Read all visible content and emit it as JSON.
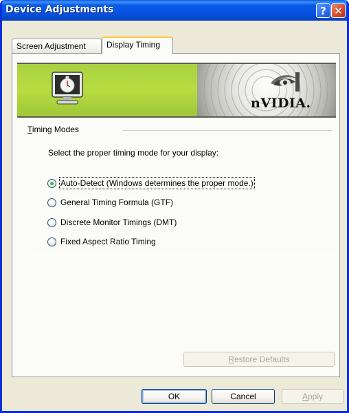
{
  "window": {
    "title": "Device Adjustments",
    "help_symbol": "?",
    "close_symbol": "✕",
    "accent": "#0a5ce6"
  },
  "tabs": [
    {
      "label": "Screen Adjustment",
      "active": false
    },
    {
      "label": "Display Timing",
      "active": true
    }
  ],
  "banner": {
    "left_icon": "monitor-stopwatch-icon",
    "brand": "nVIDIA.",
    "brand_icon": "nvidia-eye-icon",
    "green": "#a9d142"
  },
  "timing": {
    "group_label_accel": "T",
    "group_label_rest": "iming Modes",
    "instruction": "Select the proper timing mode for your display:",
    "options": [
      {
        "label": "Auto-Detect (Windows determines the proper mode.)",
        "checked": true
      },
      {
        "label": "General Timing Formula (GTF)",
        "checked": false
      },
      {
        "label": "Discrete Monitor Timings (DMT)",
        "checked": false
      },
      {
        "label": "Fixed Aspect Ratio Timing",
        "checked": false
      }
    ]
  },
  "buttons": {
    "restore_accel": "R",
    "restore_rest": "estore Defaults",
    "ok": "OK",
    "cancel": "Cancel",
    "apply_accel": "A",
    "apply_rest": "pply"
  }
}
